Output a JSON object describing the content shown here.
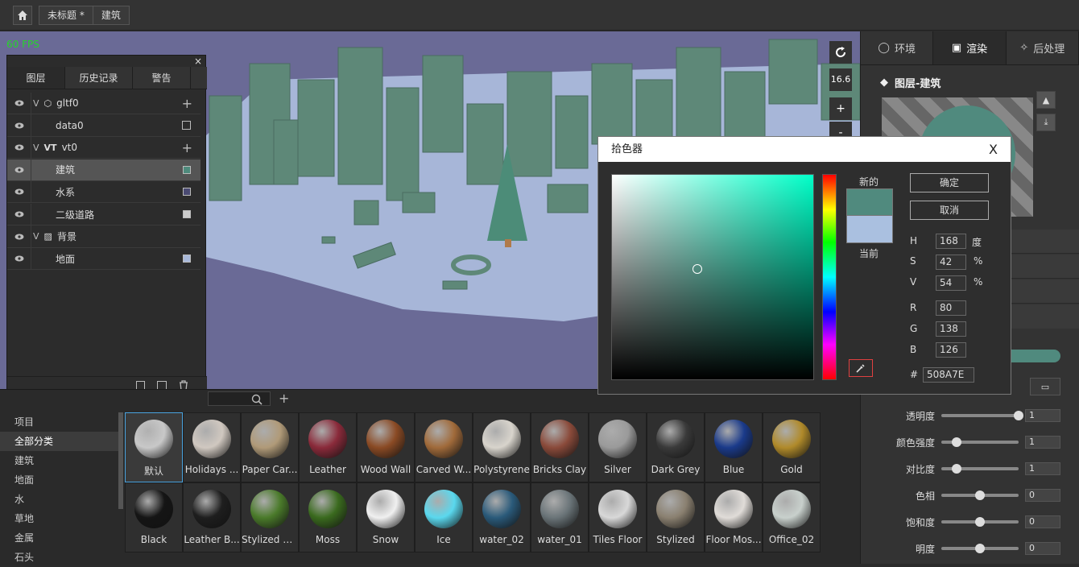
{
  "topbar": {
    "doc_title": "未标题 *",
    "crumb": "建筑"
  },
  "viewport": {
    "fps": "60 FPS",
    "zoom_value": "16.6",
    "zoom_in": "+",
    "zoom_out": "-"
  },
  "layers_panel": {
    "close": "×",
    "tabs": [
      "图层",
      "历史记录",
      "警告"
    ],
    "rows": [
      {
        "label": "gltf0",
        "type": "model",
        "swatch": ""
      },
      {
        "label": "data0",
        "type": "item",
        "swatch": ""
      },
      {
        "label": "vt0",
        "prefix": "VT",
        "type": "group",
        "swatch": ""
      },
      {
        "label": "建筑",
        "type": "item",
        "swatch": "#4e8a7c"
      },
      {
        "label": "水系",
        "type": "item",
        "swatch": "#4a4a72"
      },
      {
        "label": "二级道路",
        "type": "item",
        "swatch": "#cccccc"
      },
      {
        "label": "背景",
        "type": "group",
        "swatch": ""
      },
      {
        "label": "地面",
        "type": "item",
        "swatch": "#a9b9da"
      }
    ]
  },
  "right_panel": {
    "tabs": [
      {
        "label": "环境",
        "icon": "bulb-icon"
      },
      {
        "label": "渲染",
        "icon": "camera-icon"
      },
      {
        "label": "后处理",
        "icon": "magic-wand-icon"
      }
    ],
    "title": "图层-建筑",
    "sliders": [
      {
        "label": "透明度",
        "value": "1",
        "level": 1.0
      },
      {
        "label": "颜色强度",
        "value": "1",
        "level": 0.2
      },
      {
        "label": "对比度",
        "value": "1",
        "level": 0.2
      },
      {
        "label": "色相",
        "value": "0",
        "level": 0.5
      },
      {
        "label": "饱和度",
        "value": "0",
        "level": 0.5
      },
      {
        "label": "明度",
        "value": "0",
        "level": 0.5
      }
    ]
  },
  "library": {
    "categories": [
      "项目",
      "全部分类",
      "建筑",
      "地面",
      "水",
      "草地",
      "金属",
      "石头"
    ],
    "selected_category": "全部分类",
    "materials": [
      {
        "name": "默认",
        "color": "#c8c8c8"
      },
      {
        "name": "Holidays ...",
        "color": "#d0c8c0"
      },
      {
        "name": "Paper Car...",
        "color": "#b09a78"
      },
      {
        "name": "Leather",
        "color": "#8a2a3a"
      },
      {
        "name": "Wood Wall",
        "color": "#8a4a24"
      },
      {
        "name": "Carved W...",
        "color": "#a06a3a"
      },
      {
        "name": "Polystyrene",
        "color": "#d8d4cc"
      },
      {
        "name": "Bricks Clay",
        "color": "#8a4a3a"
      },
      {
        "name": "Silver",
        "color": "#9a9a9a"
      },
      {
        "name": "Dark Grey",
        "color": "#3a3a3a"
      },
      {
        "name": "Blue",
        "color": "#1a3a8a"
      },
      {
        "name": "Gold",
        "color": "#b08a2a"
      },
      {
        "name": "Black",
        "color": "#151515"
      },
      {
        "name": "Leather B...",
        "color": "#1e1e1e"
      },
      {
        "name": "Stylized G...",
        "color": "#4a7a2a"
      },
      {
        "name": "Moss",
        "color": "#3a6a1e"
      },
      {
        "name": "Snow",
        "color": "#f0f0f0"
      },
      {
        "name": "Ice",
        "color": "#5ad8ee"
      },
      {
        "name": "water_02",
        "color": "#2a5a7a"
      },
      {
        "name": "water_01",
        "color": "#6a7478"
      },
      {
        "name": "Tiles Floor",
        "color": "#d8d8d8"
      },
      {
        "name": "Stylized",
        "color": "#8a8070"
      },
      {
        "name": "Floor Mos...",
        "color": "#e0dcd8"
      },
      {
        "name": "Office_02",
        "color": "#c8d0cc"
      }
    ]
  },
  "color_picker": {
    "title": "拾色器",
    "close": "X",
    "new_label": "新的",
    "current_label": "当前",
    "ok": "确定",
    "cancel": "取消",
    "h": "168",
    "h_unit": "度",
    "s": "42",
    "s_unit": "%",
    "v": "54",
    "v_unit": "%",
    "r": "80",
    "g": "138",
    "b": "126",
    "hex": "508A7E",
    "labels": {
      "h": "H",
      "s": "S",
      "v": "V",
      "r": "R",
      "g": "G",
      "b": "B",
      "hex": "#"
    },
    "new_color": "#508a7e",
    "current_color": "#aac0e0"
  }
}
